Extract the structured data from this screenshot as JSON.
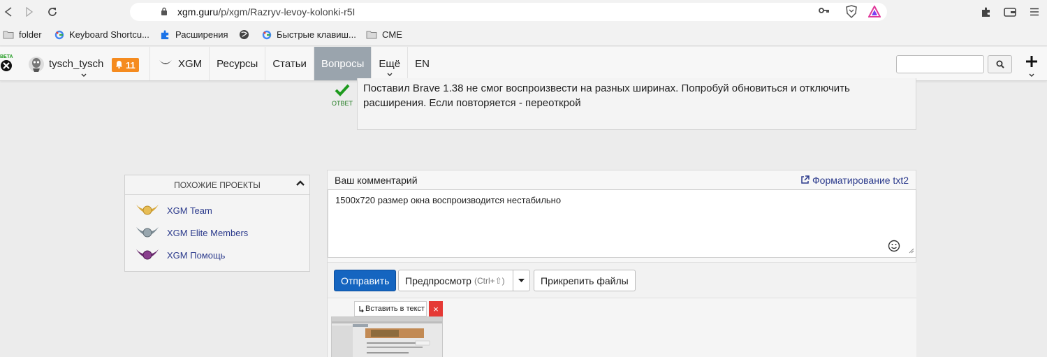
{
  "browser": {
    "url_host": "xgm.guru",
    "url_path": "/p/xgm/Razryv-levoy-kolonki-r5I",
    "bookmarks": [
      {
        "label": "folder",
        "icon": "folder-icon"
      },
      {
        "label": "Keyboard Shortcu...",
        "icon": "google-icon"
      },
      {
        "label": "Расширения",
        "icon": "puzzle-icon"
      },
      {
        "label": "Быстрые клавиш...",
        "icon": "google-icon"
      },
      {
        "label": "CME",
        "icon": "folder-icon"
      }
    ]
  },
  "header": {
    "beta_label": "BETA",
    "username": "tysch_tysch",
    "notifications": "11",
    "menu": [
      {
        "label": "XGM"
      },
      {
        "label": "Ресурсы"
      },
      {
        "label": "Статьи"
      },
      {
        "label": "Вопросы",
        "active": true
      },
      {
        "label": "Ещё"
      },
      {
        "label": "EN"
      }
    ],
    "search_placeholder": ""
  },
  "answer": {
    "mark_label": "ОТВЕТ",
    "text": "Поставил Brave 1.38 не смог воспроизвести на разных ширинах. Попробуй обновиться и отключить расширения. Если повторяется - переоткрой"
  },
  "similar": {
    "title": "ПОХОЖИЕ ПРОЕКТЫ",
    "projects": [
      {
        "title": "XGM Team",
        "color": "#d9a93a"
      },
      {
        "title": "XGM Elite Members",
        "color": "#7b8a93"
      },
      {
        "title": "XGM Помощь",
        "color": "#6a2a6e"
      }
    ]
  },
  "comment": {
    "heading": "Ваш комментарий",
    "format_link": "Форматирование txt2",
    "text": "1500x720 размер окна воспроизводится нестабильно",
    "submit_label": "Отправить",
    "preview_label": "Предпросмотр",
    "preview_hint": "(Ctrl+⇧)",
    "attach_label": "Прикрепить файлы",
    "insert_label": "Вставить в текст",
    "close_label": "×"
  },
  "colors": {
    "accent": "#1565c0",
    "notif": "#f58b1f",
    "active_menu": "#9aa4ad",
    "link": "#2b3a8c"
  }
}
